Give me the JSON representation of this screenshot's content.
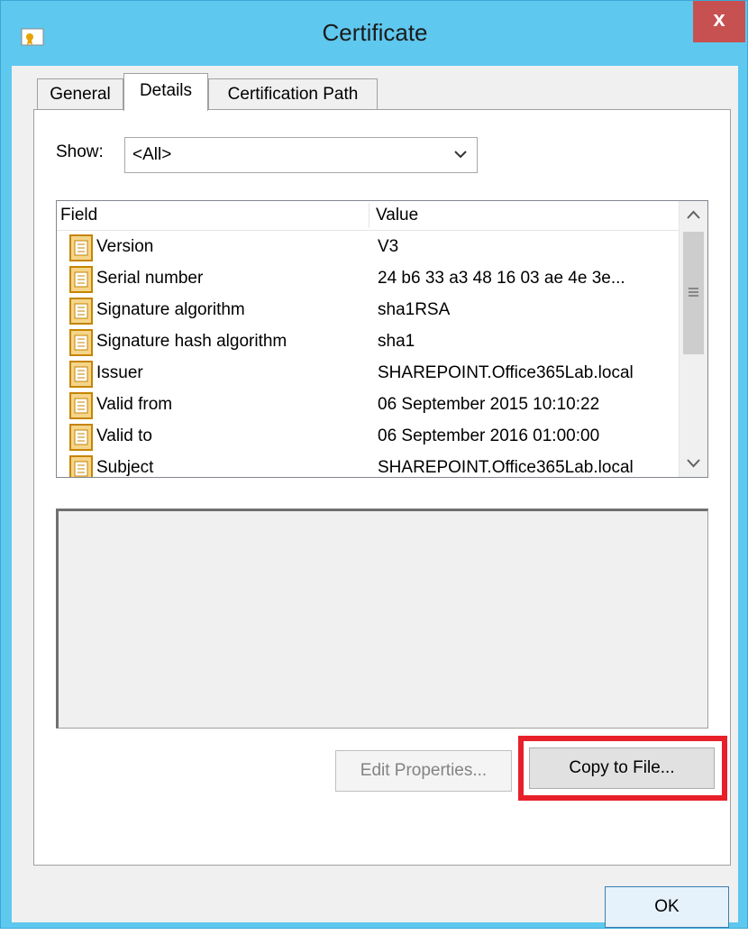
{
  "window": {
    "title": "Certificate",
    "close_glyph": "x"
  },
  "tabs": [
    {
      "label": "General",
      "active": false
    },
    {
      "label": "Details",
      "active": true
    },
    {
      "label": "Certification Path",
      "active": false
    }
  ],
  "show": {
    "label": "Show:",
    "value": "<All>"
  },
  "list": {
    "columns": [
      "Field",
      "Value"
    ],
    "rows": [
      {
        "field": "Version",
        "value": "V3"
      },
      {
        "field": "Serial number",
        "value": "24 b6 33 a3 48 16 03 ae 4e 3e..."
      },
      {
        "field": "Signature algorithm",
        "value": "sha1RSA"
      },
      {
        "field": "Signature hash algorithm",
        "value": "sha1"
      },
      {
        "field": "Issuer",
        "value": "SHAREPOINT.Office365Lab.local"
      },
      {
        "field": "Valid from",
        "value": "06 September 2015 10:10:22"
      },
      {
        "field": "Valid to",
        "value": "06 September 2016 01:00:00"
      },
      {
        "field": "Subject",
        "value": "SHAREPOINT.Office365Lab.local"
      }
    ]
  },
  "buttons": {
    "edit_properties": "Edit Properties...",
    "copy_to_file": "Copy to File...",
    "ok": "OK"
  },
  "colors": {
    "titlebar": "#5ec8ef",
    "close": "#c75050",
    "highlight": "#e8202a",
    "icon_gold": "#e8a200"
  }
}
